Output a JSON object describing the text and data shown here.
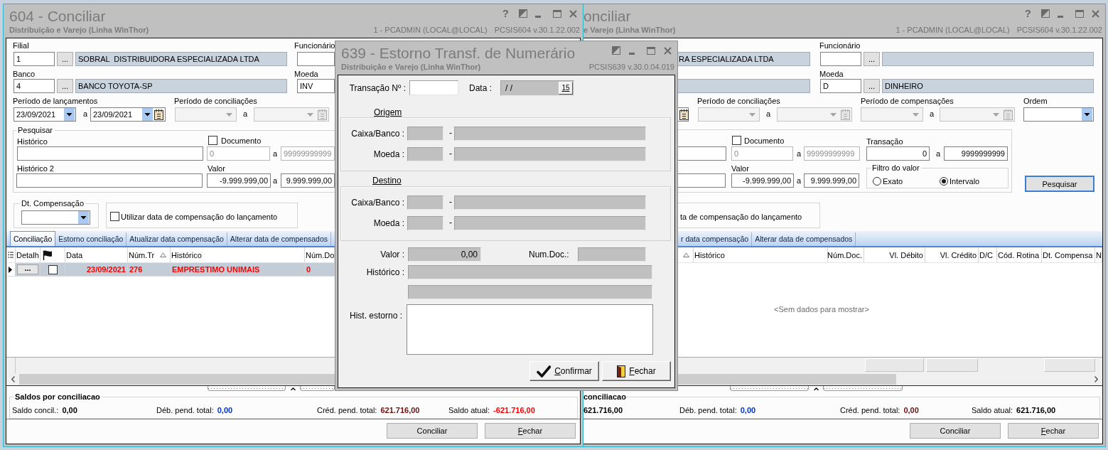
{
  "left_window": {
    "title": "604 - Conciliar",
    "subtitle": "Distribuição e Varejo (Linha WinThor)",
    "controls": [
      {
        "kind": "help",
        "text": "?"
      },
      {
        "kind": "restore"
      },
      {
        "kind": "minimize"
      },
      {
        "kind": "maximize"
      },
      {
        "kind": "close"
      }
    ],
    "session": "1 - PCADMIN (LOCAL@LOCAL)",
    "version": "PCSIS604 v.30.1.22.002",
    "filial": {
      "label": "Filial",
      "code": "1",
      "lookup": "...",
      "description": "SOBRAL  DISTRIBUIDORA ESPECIALIZADA LTDA"
    },
    "funcionario": {
      "label": "Funcionário"
    },
    "banco": {
      "label": "Banco",
      "code": "4",
      "lookup": "...",
      "description": "BANCO TOYOTA-SP"
    },
    "moeda": {
      "label": "Moeda",
      "code": "INV"
    },
    "periodo_lancamentos": {
      "label": "Período de lançamentos",
      "from": "23/09/2021",
      "separator": "a",
      "to": "23/09/2021",
      "disabled": false
    },
    "periodo_conciliacoes": {
      "label": "Período de conciliações",
      "separator": "a",
      "disabled": true
    },
    "pesquisar": {
      "legend": "Pesquisar",
      "historico": {
        "label": "Histórico"
      },
      "documento": {
        "label": "Documento",
        "checked": false,
        "from": "0",
        "separator": "a",
        "to": "99999999999"
      },
      "historico_2": {
        "label": "Histórico 2"
      },
      "valor": {
        "label": "Valor",
        "from": "-9.999.999,00",
        "separator": "a",
        "to": "9.999.999,00"
      }
    },
    "dt_compensacao": {
      "legend": "Dt. Compensação"
    },
    "usar_data_compensacao": {
      "label": "Utilizar data de compensação do lançamento",
      "checked": false
    },
    "tabs": [
      {
        "label": "Conciliação",
        "selected": true
      },
      {
        "label": "Estorno conciliação",
        "selected": false
      },
      {
        "label": "Atualizar data compensação",
        "selected": false
      },
      {
        "label": "Alterar data de compensados",
        "selected": false
      }
    ],
    "grid": {
      "columns": [
        {
          "kind": "menu",
          "sorted": false
        },
        {
          "kind": "text",
          "label": "Detalh",
          "sorted": false
        },
        {
          "kind": "flag",
          "sorted": false
        },
        {
          "kind": "text",
          "label": "Data",
          "sorted": false
        },
        {
          "kind": "text",
          "label": "Núm.Tr",
          "sorted": true
        },
        {
          "kind": "text",
          "label": "Histórico",
          "sorted": false
        },
        {
          "kind": "text",
          "label": "Núm.Do"
        }
      ],
      "rows": [
        {
          "selected": true,
          "color": "#ff0000",
          "cells": [
            {
              "kind": "indicator"
            },
            {
              "kind": "button",
              "text": "..."
            },
            {
              "kind": "checkbox",
              "checked": false
            },
            {
              "kind": "text",
              "text": "23/09/2021"
            },
            {
              "kind": "text",
              "text": "276"
            },
            {
              "kind": "text",
              "text": "EMPRESTIMO UNIMAIS"
            },
            {
              "kind": "text",
              "text": "0"
            }
          ]
        }
      ]
    },
    "totals": {
      "legend": "Saldos por conciliacao",
      "items": [
        {
          "label": "Saldo concil.:",
          "value": "0,00",
          "color": "#000000"
        },
        {
          "label": "Déb. pend. total:",
          "value": "0,00",
          "color": "#0033cc"
        },
        {
          "label": "Créd. pend. total:",
          "value": "621.716,00",
          "color": "#6e1010"
        },
        {
          "label": "Saldo atual:",
          "value": "-621.716,00",
          "color": "#ff0000"
        }
      ]
    },
    "buttons": [
      {
        "label": "Conciliar",
        "mnemonic": false
      },
      {
        "label": "Fechar",
        "mnemonic": true
      }
    ]
  },
  "right_window": {
    "title": "onciliar",
    "subtitle": "e Varejo (Linha WinThor)",
    "controls": [
      {
        "kind": "help",
        "text": "?"
      },
      {
        "kind": "restore"
      },
      {
        "kind": "minimize"
      },
      {
        "kind": "maximize"
      },
      {
        "kind": "close"
      }
    ],
    "session": "1 - PCADMIN (LOCAL@LOCAL)",
    "version": "PCSIS604 v.30.1.22.002",
    "filial": {
      "description": "RA ESPECIALIZADA LTDA"
    },
    "funcionario": {
      "label": "Funcionário",
      "lookup": "..."
    },
    "moeda": {
      "label": "Moeda",
      "code": "D",
      "lookup": "...",
      "description": "DINHEIRO"
    },
    "periodo_conciliacoes": {
      "label": "Período de conciliações",
      "separator": "a",
      "disabled": true
    },
    "periodo_compensacoes": {
      "label": "Período de compensações",
      "separator": "a",
      "disabled": true
    },
    "ordem": {
      "label": "Ordem"
    },
    "pesquisar": {
      "documento": {
        "label": "Documento",
        "checked": false,
        "from": "0",
        "separator": "a",
        "to": "99999999999"
      },
      "transacao": {
        "label": "Transação",
        "from": "0",
        "separator": "a",
        "to": "9999999999"
      },
      "valor": {
        "label": "Valor",
        "from": "-9.999.999,00",
        "separator": "a",
        "to": "9.999.999,00"
      },
      "filtro_valor": {
        "legend": "Filtro do valor",
        "options": [
          {
            "label": "Exato",
            "selected": false
          },
          {
            "label": "Intervalo",
            "selected": true
          }
        ]
      }
    },
    "search_button": {
      "label": "Pesquisar",
      "focused": true
    },
    "usar_data_compensacao": {
      "label": "ta de compensação do lançamento"
    },
    "tabs": [
      {
        "label": "r data compensação",
        "selected": false
      },
      {
        "label": "Alterar data de compensados",
        "selected": false
      }
    ],
    "grid": {
      "columns": [
        {
          "kind": "text",
          "sorted": true
        },
        {
          "kind": "text",
          "label": "Histórico",
          "sorted": false
        },
        {
          "kind": "text",
          "label": "Núm.Doc.",
          "sorted": false
        },
        {
          "kind": "text",
          "label": "Vl. Débito",
          "sorted": false
        },
        {
          "kind": "text",
          "label": "Vl. Crédito",
          "sorted": false
        },
        {
          "kind": "text",
          "label": "D/C",
          "sorted": false
        },
        {
          "kind": "text",
          "label": "Cód. Rotina",
          "sorted": false
        },
        {
          "kind": "text",
          "label": "Dt. Compensa",
          "sorted": false
        },
        {
          "kind": "text",
          "label": "N",
          "sorted": false
        }
      ],
      "empty_text": "<Sem dados para mostrar>"
    },
    "totals": {
      "legend": "conciliacao",
      "items": [
        {
          "value": "621.716,00",
          "color": "#000000"
        },
        {
          "label": "Déb. pend. total:",
          "value": "0,00",
          "color": "#0033cc"
        },
        {
          "label": "Créd. pend. total:",
          "value": "0,00",
          "color": "#6e1010"
        },
        {
          "label": "Saldo atual:",
          "value": "621.716,00",
          "color": "#000000"
        }
      ]
    },
    "buttons": [
      {
        "label": "Conciliar",
        "mnemonic": false
      },
      {
        "label": "Fechar",
        "mnemonic": true
      }
    ]
  },
  "dialog": {
    "title": "639 - Estorno Transf. de Numerário",
    "subtitle": "Distribuição e Varejo (Linha WinThor)",
    "controls": [
      {
        "kind": "restore"
      },
      {
        "kind": "minimize"
      },
      {
        "kind": "maximize"
      },
      {
        "kind": "close"
      }
    ],
    "version": "PCSIS639 v.30.0.04.019",
    "transacao": {
      "label": "Transação Nº :"
    },
    "data": {
      "label": "Data :",
      "value": "/ /",
      "calendar": "15",
      "disabled": true
    },
    "sections": [
      {
        "title": "Origem",
        "rows": [
          {
            "label": "Caixa/Banco :",
            "separator": "-",
            "disabled": true
          },
          {
            "label": "Moeda :",
            "separator": "-",
            "disabled": true
          }
        ]
      },
      {
        "title": "Destino",
        "rows": [
          {
            "label": "Caixa/Banco :",
            "separator": "-",
            "disabled": true
          },
          {
            "label": "Moeda :",
            "separator": "-",
            "disabled": true
          }
        ]
      }
    ],
    "valor": {
      "label": "Valor :",
      "value": "0,00",
      "disabled": true
    },
    "num_doc": {
      "label": "Num.Doc.:",
      "disabled": true
    },
    "historico": {
      "label": "Histórico :",
      "disabled": true
    },
    "hist_estorno": {
      "label": "Hist. estorno :"
    },
    "buttons": [
      {
        "kind": "confirm",
        "label": "Confirmar",
        "mnemonic": true
      },
      {
        "kind": "close",
        "label": "Fechar",
        "mnemonic": true
      }
    ]
  }
}
